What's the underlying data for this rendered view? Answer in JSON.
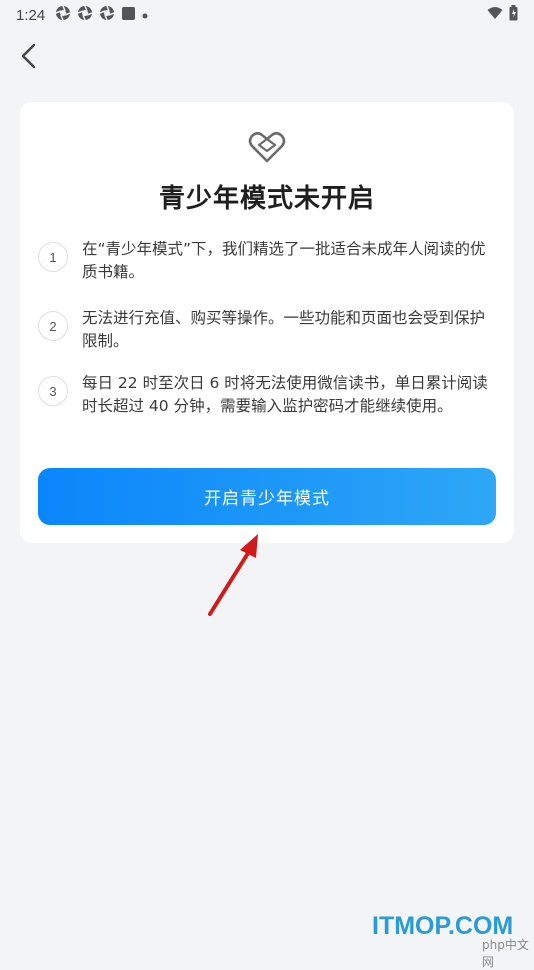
{
  "status_bar": {
    "time": "1:24"
  },
  "card": {
    "title": "青少年模式未开启",
    "items": [
      {
        "number": "1",
        "text": "在“青少年模式”下，我们精选了一批适合未成年人阅读的优质书籍。"
      },
      {
        "number": "2",
        "text": "无法进行充值、购买等操作。一些功能和页面也会受到保护限制。"
      },
      {
        "number": "3",
        "text": "每日 22 时至次日 6 时将无法使用微信读书，单日累计阅读时长超过 40 分钟，需要输入监护密码才能继续使用。"
      }
    ],
    "button_label": "开启青少年模式"
  },
  "watermark": {
    "brand": "ITMOP.COM",
    "sub": "php中文网"
  },
  "colors": {
    "button_gradient_start": "#0a86fb",
    "button_gradient_end": "#2ea7f6",
    "background": "#f3f4f6",
    "annotation_arrow": "#d11a1a"
  },
  "icons": [
    "aperture-icon",
    "stop-square-icon",
    "wifi-icon",
    "battery-icon",
    "back-chevron-icon",
    "shield-heart-icon"
  ]
}
